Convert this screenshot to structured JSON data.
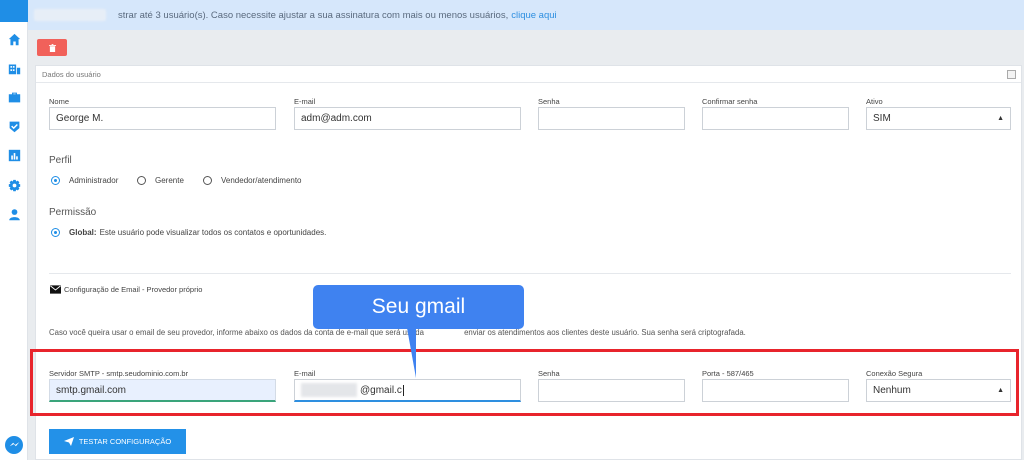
{
  "banner": {
    "text": "strar até 3 usuário(s). Caso necessite ajustar a sua assinatura com mais ou menos usuários,",
    "link": "clique aqui"
  },
  "panel": {
    "title": "Dados do usuário"
  },
  "user_fields": {
    "nome": {
      "label": "Nome",
      "value": "George M."
    },
    "email": {
      "label": "E-mail",
      "value": "adm@adm.com"
    },
    "senha": {
      "label": "Senha",
      "value": ""
    },
    "confirmar": {
      "label": "Confirmar senha",
      "value": ""
    },
    "ativo": {
      "label": "Ativo",
      "value": "SIM"
    }
  },
  "perfil": {
    "title": "Perfil",
    "options": [
      "Administrador",
      "Gerente",
      "Vendedor/atendimento"
    ],
    "selected": "Administrador"
  },
  "permissao": {
    "title": "Permissão",
    "option_bold": "Global:",
    "option_text": "Este usuário pode visualizar todos os contatos e oportunidades."
  },
  "email_config": {
    "title": "Configuração de Email - Provedor próprio",
    "description": "Caso você queira usar o email de seu provedor, informe abaixo os dados da conta de e-mail que será usada",
    "description_tail": "enviar os atendimentos aos clientes deste usuário. Sua senha será criptografada."
  },
  "smtp_fields": {
    "servidor": {
      "label": "Servidor SMTP - smtp.seudominio.com.br",
      "value": "smtp.gmail.com"
    },
    "email": {
      "label": "E-mail",
      "value": "@gmail.c"
    },
    "senha": {
      "label": "Senha",
      "value": ""
    },
    "porta": {
      "label": "Porta - 587/465",
      "value": ""
    },
    "conexao": {
      "label": "Conexão Segura",
      "value": "Nenhum"
    }
  },
  "test_button": {
    "label": "TESTAR CONFIGURAÇÃO"
  },
  "callout": {
    "text": "Seu gmail"
  },
  "colors": {
    "accent": "#1f8ee6",
    "highlight": "#e8242c",
    "callout": "#3f82f0",
    "danger": "#f1615a"
  }
}
